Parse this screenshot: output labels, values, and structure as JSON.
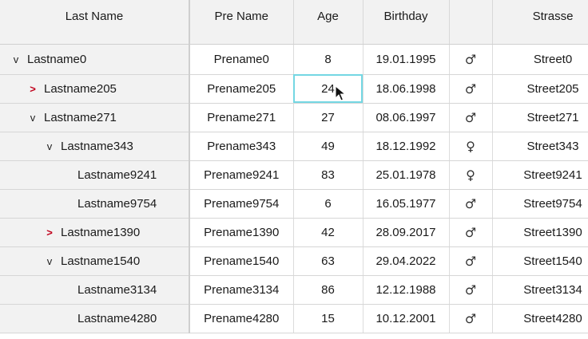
{
  "columns": {
    "last_name": "Last Name",
    "pre_name": "Pre Name",
    "age": "Age",
    "birthday": "Birthday",
    "gender": "",
    "strasse": "Strasse"
  },
  "rows": [
    {
      "last": "Lastname0",
      "pre": "Prename0",
      "age": "8",
      "bday": "19.01.1995",
      "gender": "♂",
      "street": "Street0",
      "level": 0,
      "toggle": "expanded"
    },
    {
      "last": "Lastname205",
      "pre": "Prename205",
      "age": "24",
      "bday": "18.06.1998",
      "gender": "♂",
      "street": "Street205",
      "level": 1,
      "toggle": "collapsed"
    },
    {
      "last": "Lastname271",
      "pre": "Prename271",
      "age": "27",
      "bday": "08.06.1997",
      "gender": "♂",
      "street": "Street271",
      "level": 1,
      "toggle": "expanded"
    },
    {
      "last": "Lastname343",
      "pre": "Prename343",
      "age": "49",
      "bday": "18.12.1992",
      "gender": "♀",
      "street": "Street343",
      "level": 2,
      "toggle": "expanded"
    },
    {
      "last": "Lastname9241",
      "pre": "Prename9241",
      "age": "83",
      "bday": "25.01.1978",
      "gender": "♀",
      "street": "Street9241",
      "level": 3,
      "toggle": "none"
    },
    {
      "last": "Lastname9754",
      "pre": "Prename9754",
      "age": "6",
      "bday": "16.05.1977",
      "gender": "♂",
      "street": "Street9754",
      "level": 3,
      "toggle": "none"
    },
    {
      "last": "Lastname1390",
      "pre": "Prename1390",
      "age": "42",
      "bday": "28.09.2017",
      "gender": "♂",
      "street": "Street1390",
      "level": 2,
      "toggle": "collapsed"
    },
    {
      "last": "Lastname1540",
      "pre": "Prename1540",
      "age": "63",
      "bday": "29.04.2022",
      "gender": "♂",
      "street": "Street1540",
      "level": 2,
      "toggle": "expanded"
    },
    {
      "last": "Lastname3134",
      "pre": "Prename3134",
      "age": "86",
      "bday": "12.12.1988",
      "gender": "♂",
      "street": "Street3134",
      "level": 3,
      "toggle": "none"
    },
    {
      "last": "Lastname4280",
      "pre": "Prename4280",
      "age": "15",
      "bday": "10.12.2001",
      "gender": "♂",
      "street": "Street4280",
      "level": 3,
      "toggle": "none"
    }
  ],
  "selection": {
    "row": 1,
    "column": "age"
  },
  "icons": {
    "expanded": "chevron-down-icon",
    "collapsed": "chevron-right-icon",
    "cursor": "mouse-pointer-icon"
  },
  "colors": {
    "header_bg": "#f2f2f2",
    "selection_outline": "#74d7e3",
    "collapsed_toggle": "#c0001b"
  }
}
